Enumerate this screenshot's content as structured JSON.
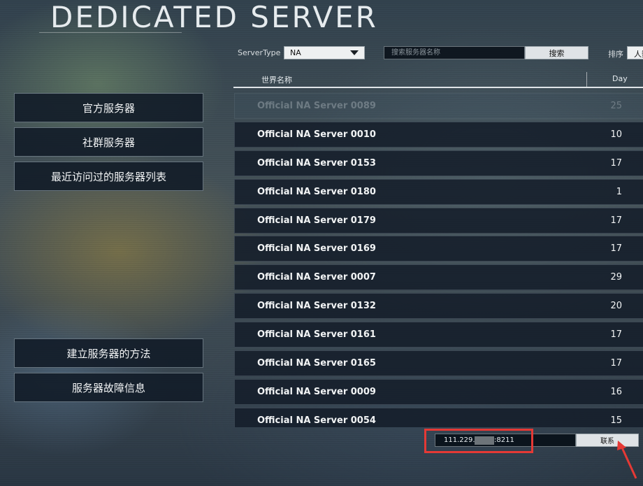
{
  "header": {
    "title": "DEDICATED SERVER"
  },
  "filters": {
    "server_type_label": "ServerType",
    "server_type_value": "NA",
    "search_placeholder": "搜索服务器名称",
    "search_button": "搜索",
    "sort_label": "排序",
    "sort_value": "人数"
  },
  "table": {
    "columns": [
      "世界名称",
      "Day"
    ],
    "rows": [
      {
        "name": "Official NA Server 0089",
        "day": "25"
      },
      {
        "name": "Official NA Server 0010",
        "day": "10"
      },
      {
        "name": "Official NA Server 0153",
        "day": "17"
      },
      {
        "name": "Official NA Server 0180",
        "day": "1"
      },
      {
        "name": "Official NA Server 0179",
        "day": "17"
      },
      {
        "name": "Official NA Server 0169",
        "day": "17"
      },
      {
        "name": "Official NA Server 0007",
        "day": "29"
      },
      {
        "name": "Official NA Server 0132",
        "day": "20"
      },
      {
        "name": "Official NA Server 0161",
        "day": "17"
      },
      {
        "name": "Official NA Server 0165",
        "day": "17"
      },
      {
        "name": "Official NA Server 0009",
        "day": "16"
      },
      {
        "name": "Official NA Server 0054",
        "day": "15"
      }
    ]
  },
  "sidebar": {
    "items": [
      {
        "label": "官方服务器"
      },
      {
        "label": "社群服务器"
      },
      {
        "label": "最近访问过的服务器列表"
      },
      {
        "label": "建立服务器的方法"
      },
      {
        "label": "服务器故障信息"
      }
    ]
  },
  "connect": {
    "ip_prefix": "111.229.",
    "ip_suffix": ":8211",
    "button": "联系"
  },
  "annotation": {
    "color": "#e53935"
  }
}
